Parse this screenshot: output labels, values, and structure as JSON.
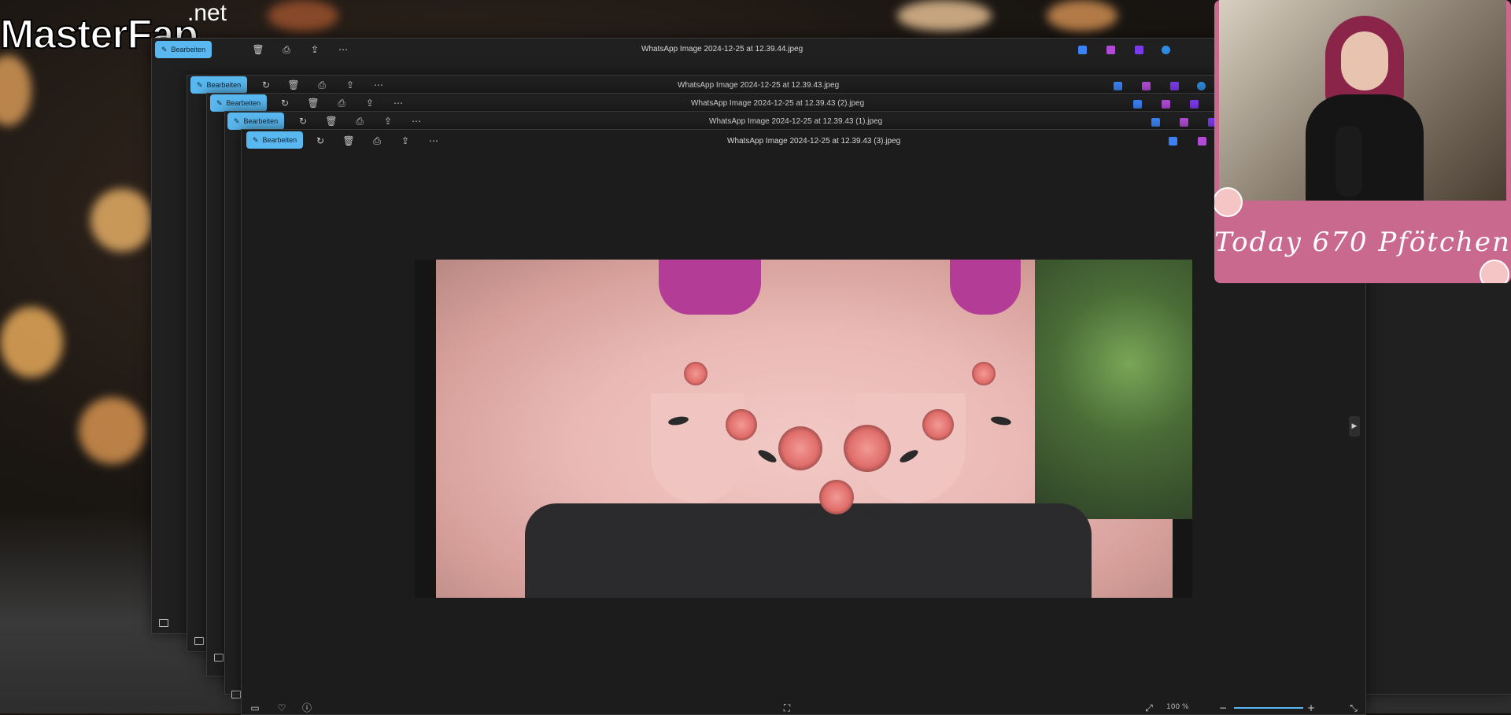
{
  "logo": {
    "main_text": "MasterFap",
    "suffix": ".net"
  },
  "colors": {
    "accent": "#59b8ef",
    "window_bg": "#202020",
    "banner_pink": "#c9698e",
    "rose": "#e06d6a"
  },
  "windows": [
    {
      "title": "WhatsApp Image 2024-12-25 at 12.39.44.jpeg",
      "edit_label": "Bearbeiten"
    },
    {
      "title": "WhatsApp Image 2024-12-25 at 12.39.43.jpeg",
      "edit_label": "Bearbeiten"
    },
    {
      "title": "WhatsApp Image 2024-12-25 at 12.39.43 (2).jpeg",
      "edit_label": "Bearbeiten"
    },
    {
      "title": "WhatsApp Image 2024-12-25 at 12.39.43 (1).jpeg",
      "edit_label": "Bearbeiten"
    },
    {
      "title": "WhatsApp Image 2024-12-25 at 12.39.43 (3).jpeg",
      "edit_label": "Bearbeiten"
    }
  ],
  "toolbar_icons": [
    "rotate-icon",
    "delete-icon",
    "print-icon",
    "share-icon",
    "more-icon"
  ],
  "webcam": {
    "banner_text": "Today 670 Pfötchen"
  },
  "statusbar": {
    "zoom": "100 %"
  }
}
